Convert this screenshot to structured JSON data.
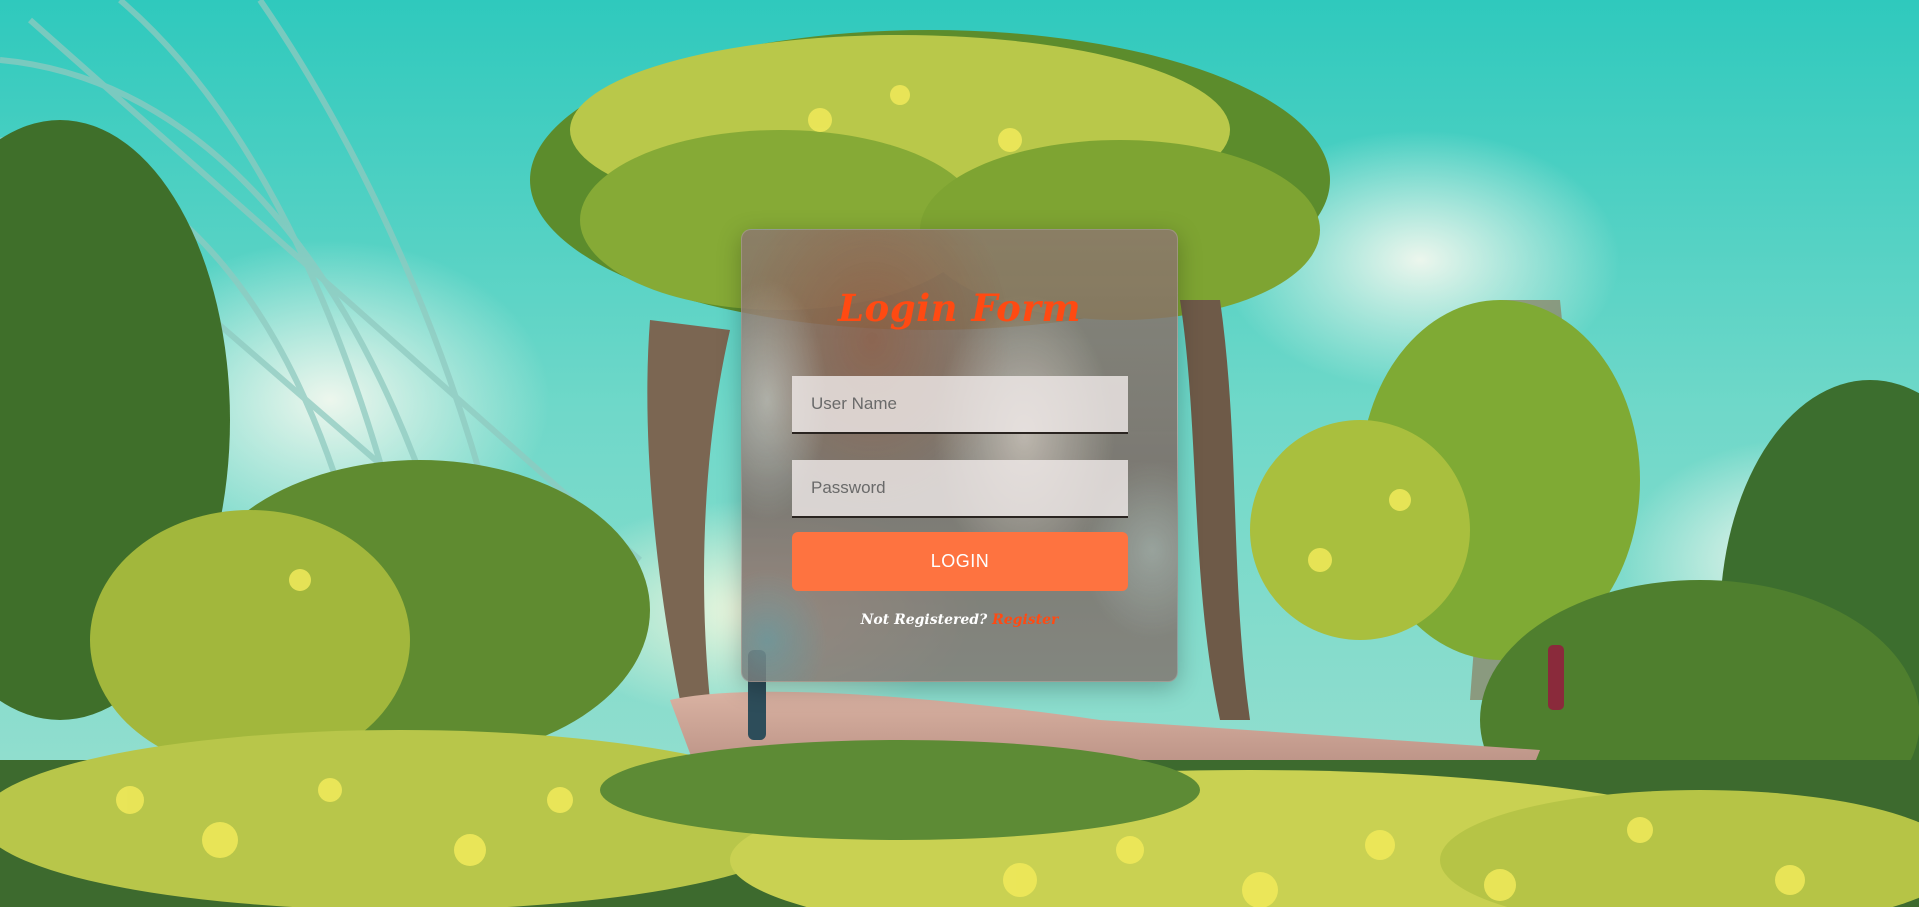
{
  "login_form": {
    "title": "Login Form",
    "username_placeholder": "User Name",
    "password_placeholder": "Password",
    "login_label": "LOGIN",
    "not_registered_text": "Not Registered?",
    "register_link_label": "Register"
  },
  "colors": {
    "title": "#ff4a12",
    "button_bg": "#fe7340",
    "button_text": "#ffffff",
    "register_link": "#ff4a12"
  }
}
